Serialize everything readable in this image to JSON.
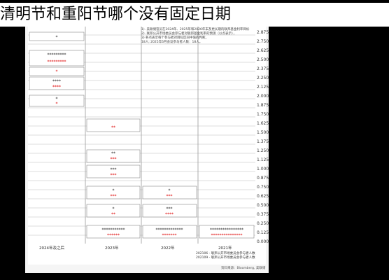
{
  "page_title": "清明节和重阳节哪个没有固定日期",
  "chart": {
    "legend_lines": [
      "1). 美联储官员在2024年、2025年和2026年末及更长期的联邦基金利率目标",
      "2). 联邦公开市场委员会参与者对联邦基金利率的预测（以点表示），",
      "3) 各点表示每个参与者对目标区间中值的判断。",
      "18人; 2025年6月会议参与者人数：18人。"
    ],
    "y_labels": [
      "2.875",
      "2.750",
      "2.625",
      "2.500",
      "2.375",
      "2.250",
      "2.125",
      "2.000",
      "1.875",
      "1.750",
      "1.625",
      "1.500",
      "1.375",
      "1.250",
      "1.125",
      "1.000",
      "0.875",
      "0.750",
      "0.625",
      "0.500",
      "0.375",
      "0.250",
      "0.125",
      "0.000"
    ],
    "x_labels": [
      "2024年及之后",
      "2023年",
      "2022年",
      "2021年"
    ],
    "bottom_legend": [
      "202106 - 联邦公开市场委员会参与者人数",
      "202109 - 联邦公开市场委员会参与者人数"
    ],
    "footer": "资料来源：Bloomberg, 美联储"
  }
}
